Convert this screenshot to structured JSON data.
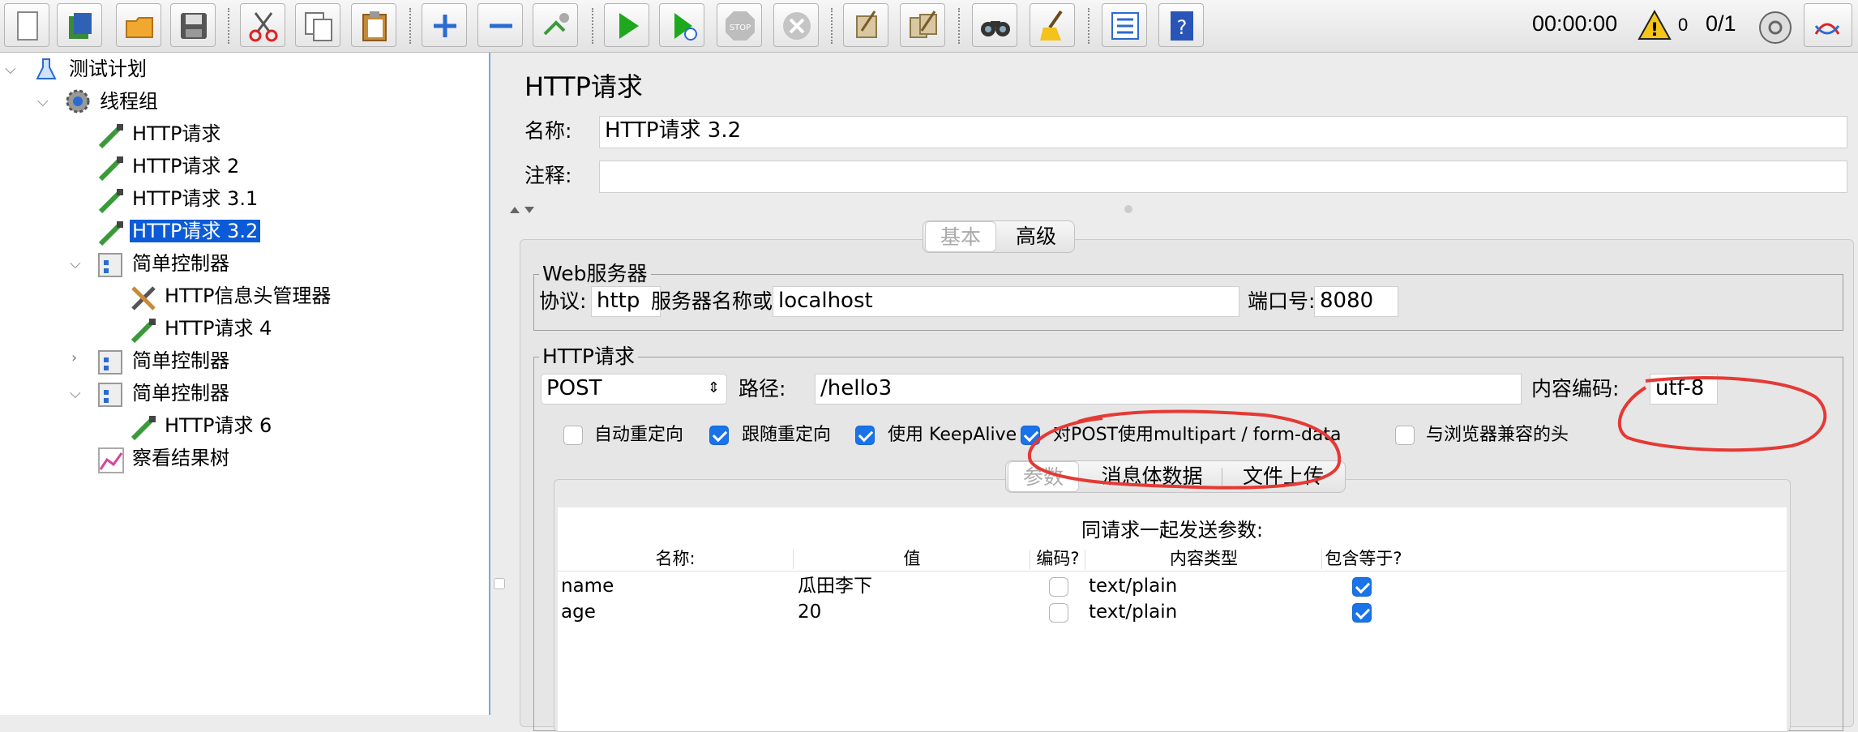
{
  "toolbar": {
    "buttons": [
      "new-icon",
      "templates-icon",
      "open-icon",
      "save-icon",
      "cut-icon",
      "copy-icon",
      "paste-icon",
      "expand-icon",
      "collapse-icon",
      "toggle-icon",
      "start-icon",
      "start-no-pause-icon",
      "stop-icon",
      "shutdown-icon",
      "clear-icon",
      "clear-all-icon",
      "search-icon",
      "reset-search-icon",
      "function-helper-icon",
      "help-icon"
    ],
    "timer": "00:00:00",
    "warnings": "0",
    "threads": "0/1"
  },
  "tree": {
    "nodes": [
      {
        "label": "测试计划"
      },
      {
        "label": "线程组"
      },
      {
        "label": "HTTP请求"
      },
      {
        "label": "HTTP请求 2"
      },
      {
        "label": "HTTP请求 3.1"
      },
      {
        "label": "HTTP请求 3.2"
      },
      {
        "label": "简单控制器"
      },
      {
        "label": "HTTP信息头管理器"
      },
      {
        "label": "HTTP请求 4"
      },
      {
        "label": "简单控制器"
      },
      {
        "label": "简单控制器"
      },
      {
        "label": "HTTP请求 6"
      },
      {
        "label": "察看结果树"
      }
    ]
  },
  "editor": {
    "title": "HTTP请求",
    "name_label": "名称:",
    "name_value": "HTTP请求 3.2",
    "comment_label": "注释:",
    "comment_value": "",
    "tabs": [
      "基本",
      "高级"
    ],
    "web_server": {
      "legend": "Web服务器",
      "protocol_label": "协议:",
      "protocol_value": "http",
      "server_label": "服务器名称或IP:",
      "server_value": "localhost",
      "port_label": "端口号:",
      "port_value": "8080"
    },
    "http_request": {
      "legend": "HTTP请求",
      "method": "POST",
      "path_label": "路径:",
      "path_value": "/hello3",
      "encoding_label": "内容编码:",
      "encoding_value": "utf-8",
      "checkboxes": [
        {
          "label": "自动重定向",
          "checked": false
        },
        {
          "label": "跟随重定向",
          "checked": true
        },
        {
          "label": "使用 KeepAlive",
          "checked": true
        },
        {
          "label": "对POST使用multipart / form-data",
          "checked": true
        },
        {
          "label": "与浏览器兼容的头",
          "checked": false
        }
      ]
    },
    "sub_tabs": [
      "参数",
      "消息体数据",
      "文件上传"
    ],
    "params": {
      "caption": "同请求一起发送参数:",
      "headers": [
        "名称:",
        "值",
        "编码?",
        "内容类型",
        "包含等于?"
      ],
      "rows": [
        {
          "name": "name",
          "value": "瓜田李下",
          "encode": false,
          "content_type": "text/plain",
          "include_equals": true
        },
        {
          "name": "age",
          "value": "20",
          "encode": false,
          "content_type": "text/plain",
          "include_equals": true
        }
      ]
    }
  },
  "colors": {
    "selection": "#0b5ad8",
    "checkbox": "#1a73e8",
    "annotation": "#e53935"
  }
}
